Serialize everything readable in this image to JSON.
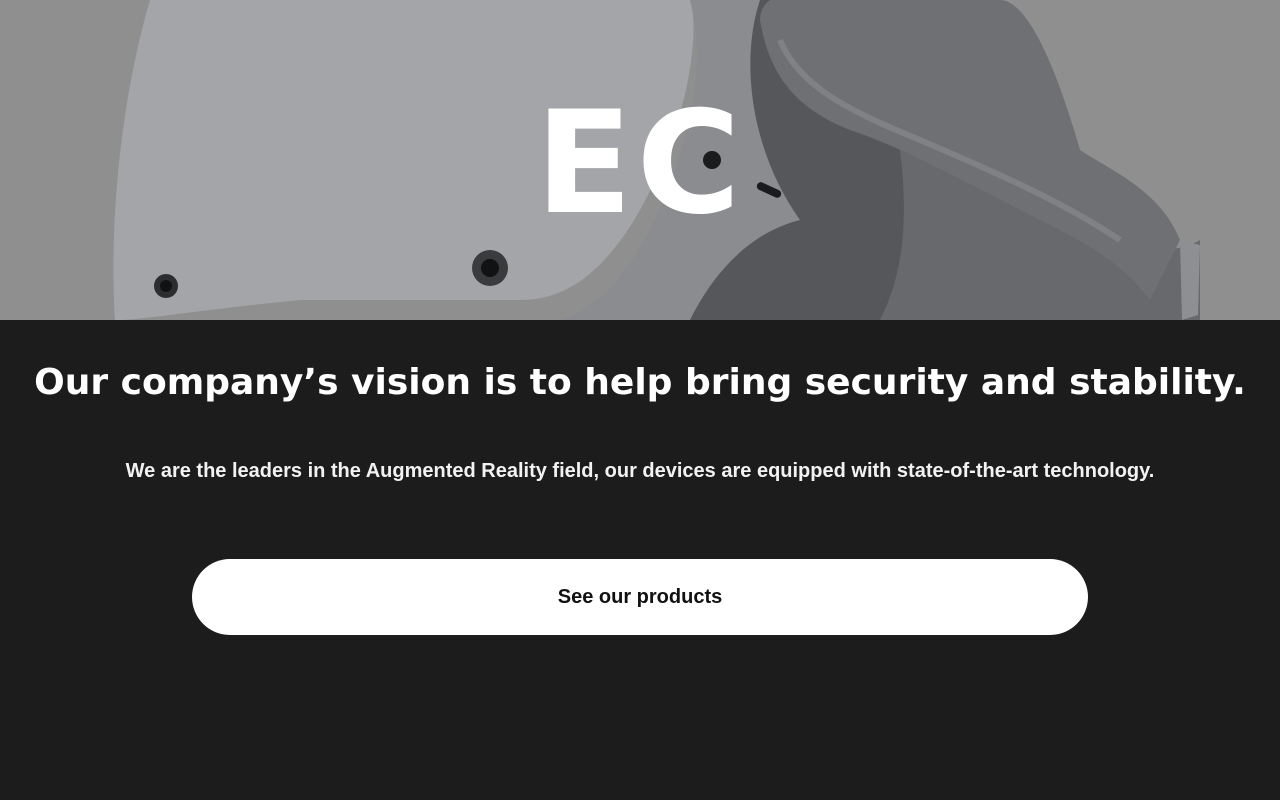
{
  "hero": {
    "logo_text": "EC",
    "image": "vr-headset-image"
  },
  "main": {
    "headline": "Our company’s vision is to help bring security and stability.",
    "subline": "We are the leaders in the Augmented Reality field, our devices are equipped with state-of-the-art technology.",
    "cta_label": "See our products"
  },
  "colors": {
    "hero_background": "#8f8f8f",
    "page_background": "#1c1c1c",
    "button_background": "#ffffff",
    "text": "#ffffff"
  }
}
